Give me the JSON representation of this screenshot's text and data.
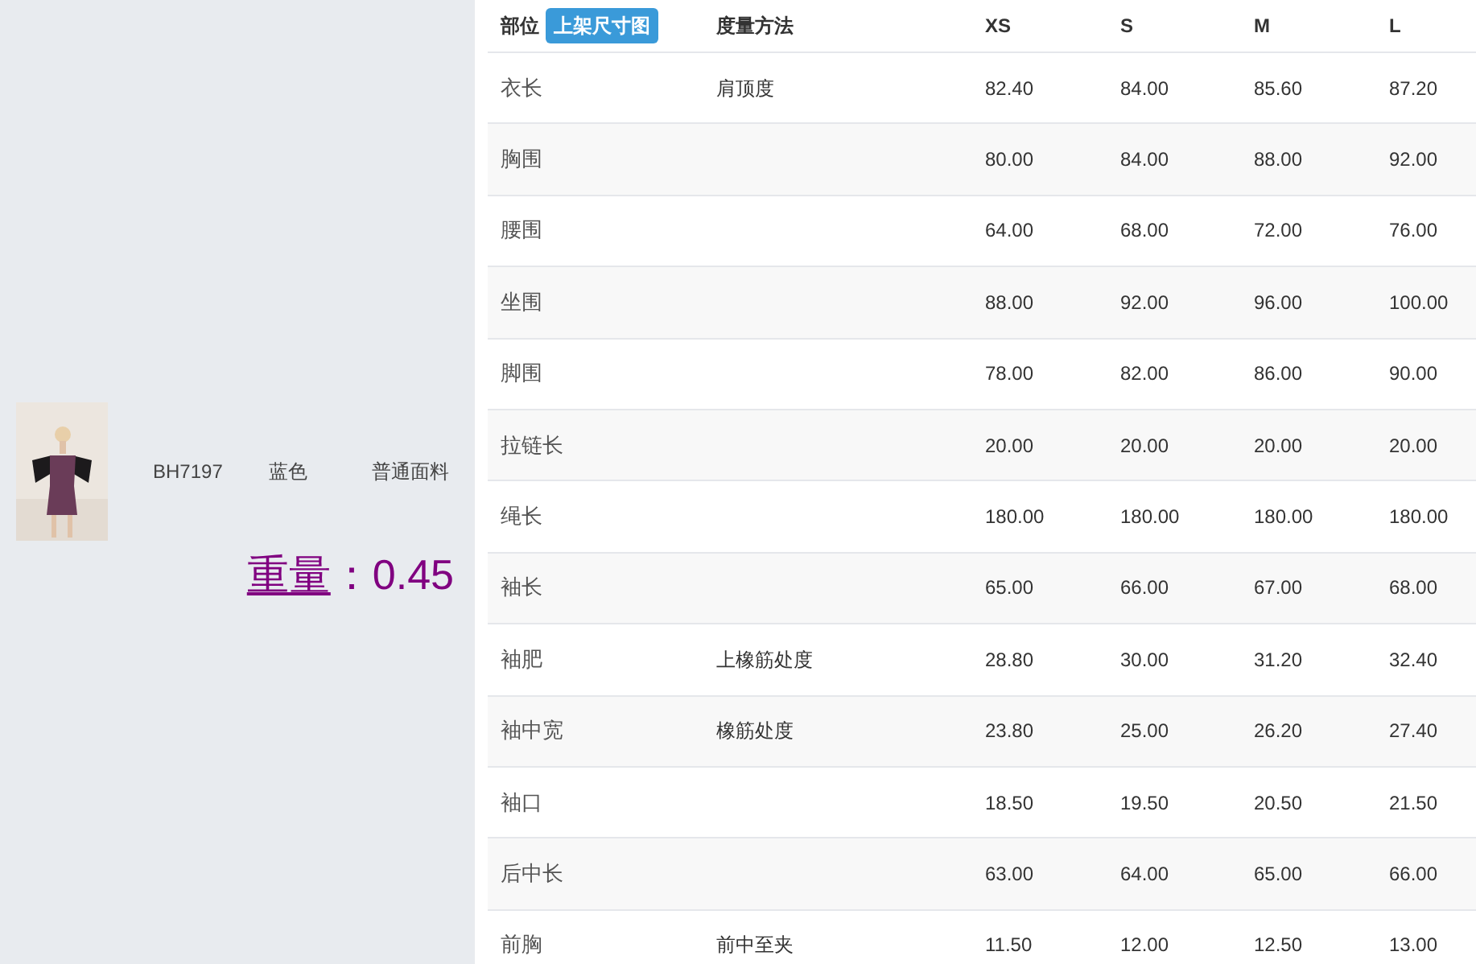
{
  "product": {
    "code": "BH7197",
    "color_name": "蓝色",
    "fabric": "普通面料",
    "weight_label": "重量",
    "weight_value": "：0.45"
  },
  "table": {
    "columns": [
      "部位",
      "度量方法",
      "XS",
      "S",
      "M",
      "L"
    ],
    "badge": "上架尺寸图",
    "rows": [
      {
        "part": "衣长",
        "method": "肩顶度",
        "values": [
          "82.40",
          "84.00",
          "85.60",
          "87.20"
        ]
      },
      {
        "part": "胸围",
        "values": [
          "80.00",
          "84.00",
          "88.00",
          "92.00"
        ]
      },
      {
        "part": "腰围",
        "values": [
          "64.00",
          "68.00",
          "72.00",
          "76.00"
        ]
      },
      {
        "part": "坐围",
        "values": [
          "88.00",
          "92.00",
          "96.00",
          "100.00"
        ]
      },
      {
        "part": "脚围",
        "values": [
          "78.00",
          "82.00",
          "86.00",
          "90.00"
        ]
      },
      {
        "part": "拉链长",
        "values": [
          "20.00",
          "20.00",
          "20.00",
          "20.00"
        ]
      },
      {
        "part": "绳长",
        "values": [
          "180.00",
          "180.00",
          "180.00",
          "180.00"
        ]
      },
      {
        "part": "袖长",
        "values": [
          "65.00",
          "66.00",
          "67.00",
          "68.00"
        ]
      },
      {
        "part": "袖肥",
        "method": "上橡筋处度",
        "values": [
          "28.80",
          "30.00",
          "31.20",
          "32.40"
        ]
      },
      {
        "part": "袖中宽",
        "method": "橡筋处度",
        "values": [
          "23.80",
          "25.00",
          "26.20",
          "27.40"
        ]
      },
      {
        "part": "袖口",
        "values": [
          "18.50",
          "19.50",
          "20.50",
          "21.50"
        ]
      },
      {
        "part": "后中长",
        "values": [
          "63.00",
          "64.00",
          "65.00",
          "66.00"
        ]
      },
      {
        "part": "前胸",
        "method": "前中至夹",
        "values": [
          "11.50",
          "12.00",
          "12.50",
          "13.00"
        ]
      }
    ]
  }
}
